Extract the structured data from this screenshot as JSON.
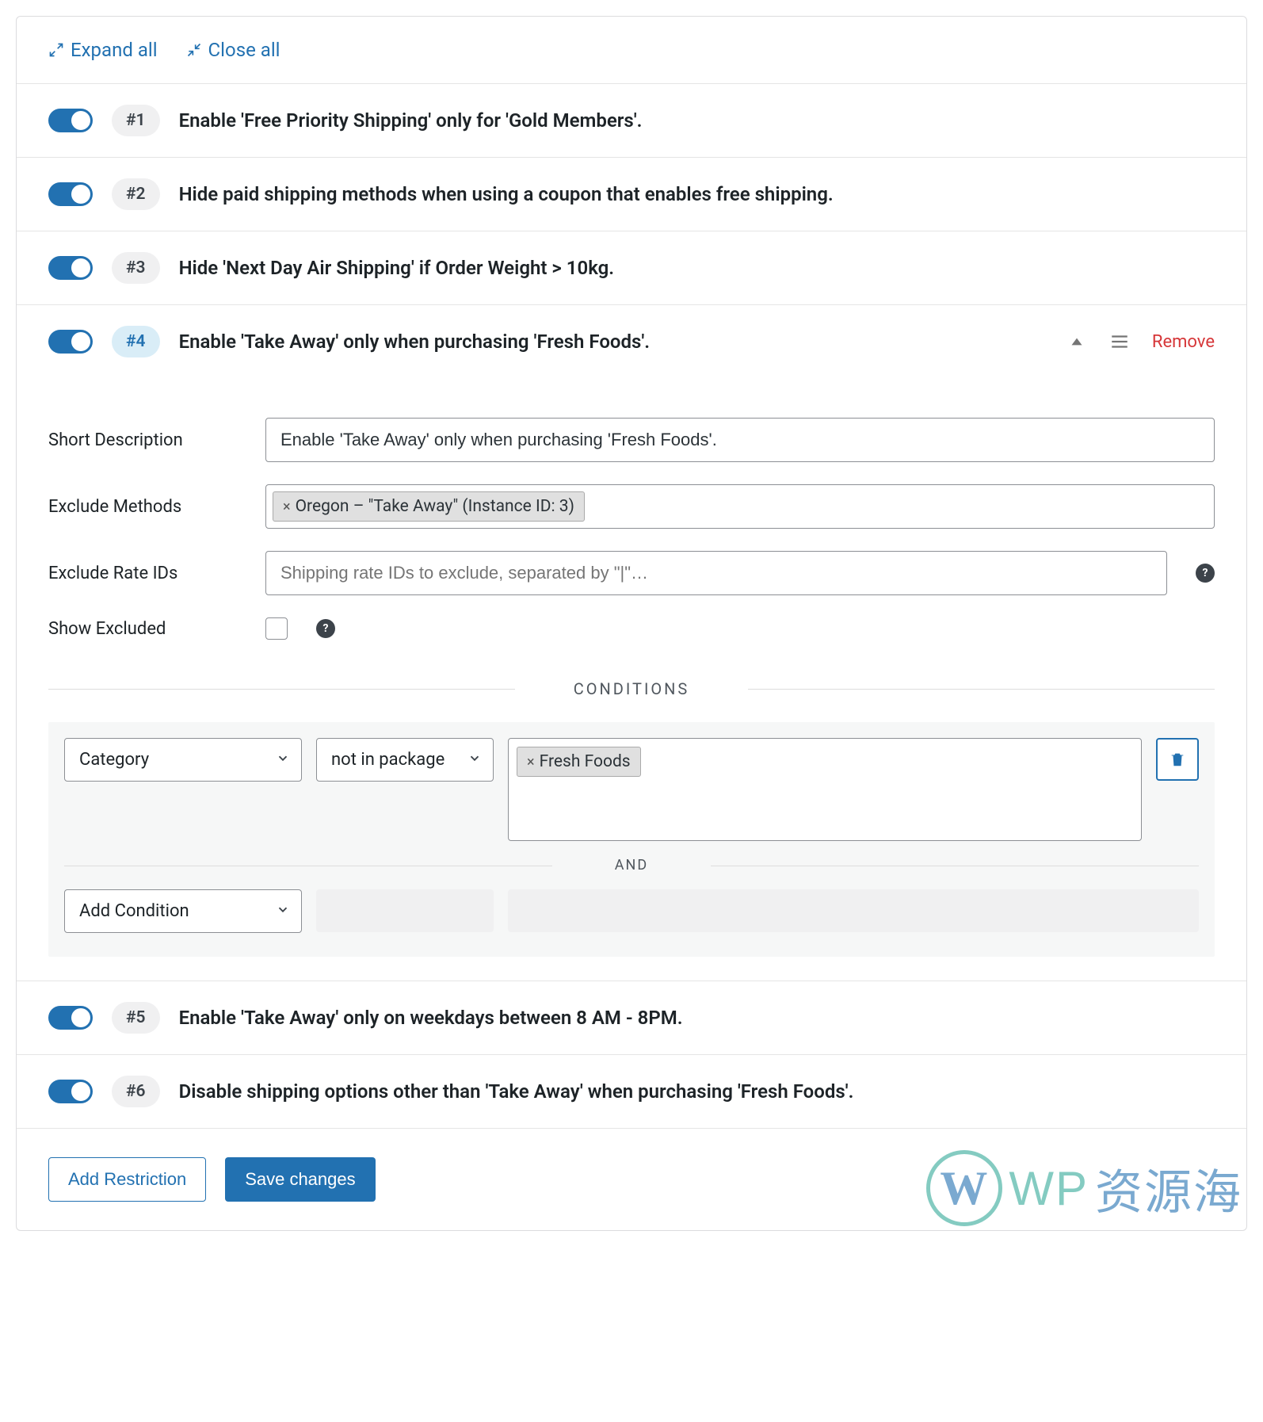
{
  "actions": {
    "expand_all": "Expand all",
    "close_all": "Close all",
    "remove": "Remove",
    "add_restriction": "Add Restriction",
    "save_changes": "Save changes"
  },
  "rules": [
    {
      "num": "#1",
      "title": "Enable 'Free Priority Shipping' only for 'Gold Members'."
    },
    {
      "num": "#2",
      "title": "Hide paid shipping methods when using a coupon that enables free shipping."
    },
    {
      "num": "#3",
      "title": "Hide 'Next Day Air Shipping' if Order Weight > 10kg."
    },
    {
      "num": "#4",
      "title": "Enable 'Take Away' only when purchasing 'Fresh Foods'."
    },
    {
      "num": "#5",
      "title": "Enable 'Take Away' only on weekdays between 8 AM - 8PM."
    },
    {
      "num": "#6",
      "title": "Disable shipping options other than 'Take Away' when purchasing 'Fresh Foods'."
    }
  ],
  "expanded": {
    "labels": {
      "short_description": "Short Description",
      "exclude_methods": "Exclude Methods",
      "exclude_rate_ids": "Exclude Rate IDs",
      "show_excluded": "Show Excluded",
      "conditions": "CONDITIONS",
      "and": "AND"
    },
    "short_description_value": "Enable 'Take Away' only when purchasing 'Fresh Foods'.",
    "exclude_methods_tag": "Oregon – \"Take Away\" (Instance ID: 3)",
    "exclude_rate_ids_placeholder": "Shipping rate IDs to exclude, separated by \"|\"…",
    "condition": {
      "field": "Category",
      "operator": "not in package",
      "value_tag": "Fresh Foods",
      "add_condition": "Add Condition"
    }
  },
  "watermark": {
    "letter": "W",
    "text1": "WP",
    "text2": "资源海"
  }
}
